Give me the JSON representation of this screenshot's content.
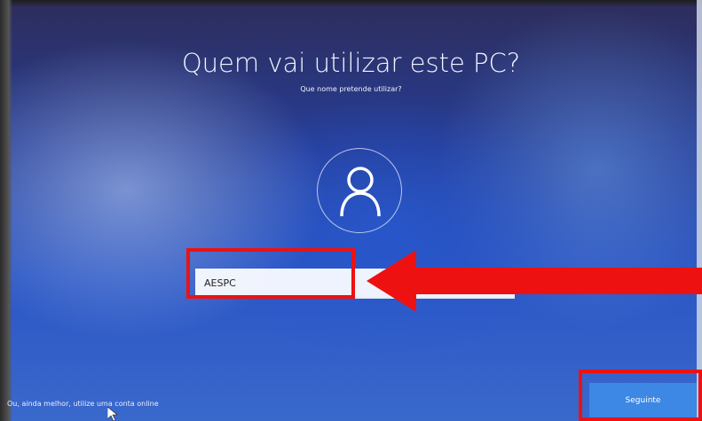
{
  "setup": {
    "title": "Quem vai utilizar este PC?",
    "subtitle": "Que nome pretende utilizar?",
    "name_input_value": "AESPC"
  },
  "footer": {
    "online_account_link": "Ou, ainda melhor, utilize uma conta online",
    "next_button_label": "Seguinte"
  },
  "icons": {
    "avatar": "user-icon",
    "annotation": "red-arrow-icon",
    "pointer": "mouse-cursor-icon"
  },
  "colors": {
    "background_blue": "#2a55c4",
    "button_blue": "#3c88e4",
    "highlight_red": "#ee1111"
  }
}
